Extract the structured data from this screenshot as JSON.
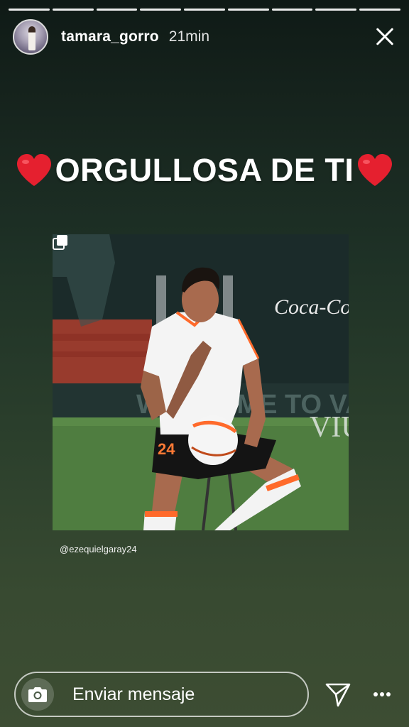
{
  "story": {
    "progress_segments": 9,
    "user": {
      "username": "tamara_gorro",
      "time_ago": "21min"
    },
    "headline": "ORGULLOSA DE TI",
    "post_credit": "@ezequielgaray24",
    "photo_watermarks": {
      "brand": "Coca-Co",
      "banner": "WELCOME TO VA",
      "letters": "VIU",
      "number": "24"
    }
  },
  "footer": {
    "message_placeholder": "Enviar mensaje"
  },
  "colors": {
    "heart": "#e5202f",
    "jersey_trim": "#ff6a2b"
  }
}
